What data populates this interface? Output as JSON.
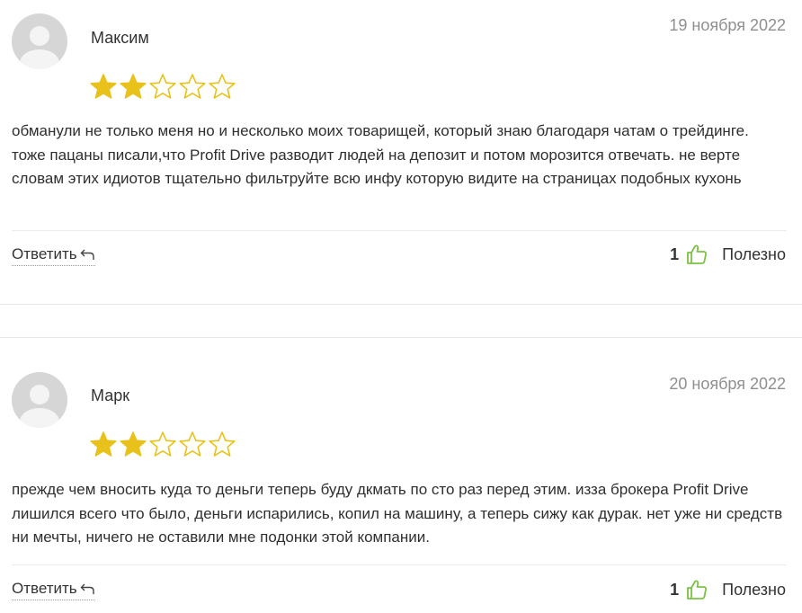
{
  "reviews": [
    {
      "author": "Максим",
      "date": "19 ноября 2022",
      "rating": 2,
      "max_rating": 5,
      "text": "обманули не только меня но и несколько моих товарищей, который знаю благодаря чатам о трейдинге. тоже пацаны писали,что Profit Drive разводит людей на депозит и потом морозится отвечать. не верте словам этих идиотов тщательно фильтруйте всю инфу которую видите на страницах подобных кухонь",
      "reply_label": "Ответить",
      "helpful_count": "1",
      "helpful_label": "Полезно"
    },
    {
      "author": "Марк",
      "date": "20 ноября 2022",
      "rating": 2,
      "max_rating": 5,
      "text": "прежде чем вносить куда то деньги теперь буду дкмать по сто раз перед этим. изза брокера Profit Drive лишился всего что было, деньги испарились, копил на машину, а теперь сижу как дурак. нет уже ни средств ни мечты, ничего не оставили мне подонки этой компании.",
      "reply_label": "Ответить",
      "helpful_count": "1",
      "helpful_label": "Полезно"
    }
  ],
  "colors": {
    "star_filled": "#e8c21a",
    "star_outline": "#e8c21a",
    "thumb": "#7cc242",
    "date": "#8f8f8f"
  },
  "icons": {
    "reply": "reply-arrow-icon",
    "thumb": "thumbs-up-icon",
    "star": "star-icon",
    "avatar": "user-avatar-placeholder-icon"
  }
}
